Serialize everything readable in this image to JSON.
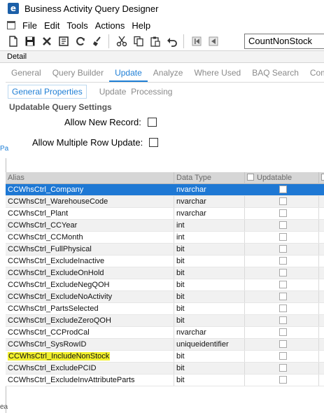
{
  "window": {
    "title": "Business Activity Query Designer",
    "icon_letter": "e"
  },
  "menu": {
    "items": [
      "File",
      "Edit",
      "Tools",
      "Actions",
      "Help"
    ]
  },
  "toolbar": {
    "icons": [
      "new-icon",
      "save-icon",
      "delete-icon",
      "undo-icon",
      "refresh-icon",
      "clear-icon",
      "cut-icon",
      "copy-icon",
      "paste-icon",
      "undo-arrow-icon",
      "first-record-icon",
      "previous-record-icon"
    ],
    "key_value": "CountNonStock"
  },
  "detail_label": "Detail",
  "tabs": [
    "General",
    "Query Builder",
    "Update",
    "Analyze",
    "Where Used",
    "BAQ Search",
    "Comm"
  ],
  "active_tab": "Update",
  "subtabs": [
    "General Properties",
    "Update  Processing"
  ],
  "active_subtab": "General Properties",
  "section": {
    "title": "Updatable Query Settings",
    "allow_new_record_label": "Allow New Record:",
    "allow_new_record": false,
    "allow_multiple_row_label": "Allow Multiple Row Update:",
    "allow_multiple_row": false
  },
  "edge_fragments": {
    "pa": "Pa",
    "ea": "ea"
  },
  "grid": {
    "columns": [
      "Alias",
      "Data Type",
      "Updatable"
    ],
    "rows": [
      {
        "alias": "CCWhsCtrl_Company",
        "type": "nvarchar",
        "updatable": false
      },
      {
        "alias": "CCWhsCtrl_WarehouseCode",
        "type": "nvarchar",
        "updatable": false
      },
      {
        "alias": "CCWhsCtrl_Plant",
        "type": "nvarchar",
        "updatable": false
      },
      {
        "alias": "CCWhsCtrl_CCYear",
        "type": "int",
        "updatable": false
      },
      {
        "alias": "CCWhsCtrl_CCMonth",
        "type": "int",
        "updatable": false
      },
      {
        "alias": "CCWhsCtrl_FullPhysical",
        "type": "bit",
        "updatable": false
      },
      {
        "alias": "CCWhsCtrl_ExcludeInactive",
        "type": "bit",
        "updatable": false
      },
      {
        "alias": "CCWhsCtrl_ExcludeOnHold",
        "type": "bit",
        "updatable": false
      },
      {
        "alias": "CCWhsCtrl_ExcludeNegQOH",
        "type": "bit",
        "updatable": false
      },
      {
        "alias": "CCWhsCtrl_ExcludeNoActivity",
        "type": "bit",
        "updatable": false
      },
      {
        "alias": "CCWhsCtrl_PartsSelected",
        "type": "bit",
        "updatable": false
      },
      {
        "alias": "CCWhsCtrl_ExcludeZeroQOH",
        "type": "bit",
        "updatable": false
      },
      {
        "alias": "CCWhsCtrl_CCProdCal",
        "type": "nvarchar",
        "updatable": false
      },
      {
        "alias": "CCWhsCtrl_SysRowID",
        "type": "uniqueidentifier",
        "updatable": false
      },
      {
        "alias": "CCWhsCtrl_IncludeNonStock",
        "type": "bit",
        "updatable": false,
        "highlighted": true
      },
      {
        "alias": "CCWhsCtrl_ExcludePCID",
        "type": "bit",
        "updatable": false
      },
      {
        "alias": "CCWhsCtrl_ExcludeInvAttributeParts",
        "type": "bit",
        "updatable": false
      }
    ],
    "selected_row": 0
  },
  "colors": {
    "accent": "#1f7fd6",
    "selected_row": "#1e78d4",
    "highlight": "#f2f02c",
    "header_bg": "#d6d6d6"
  }
}
